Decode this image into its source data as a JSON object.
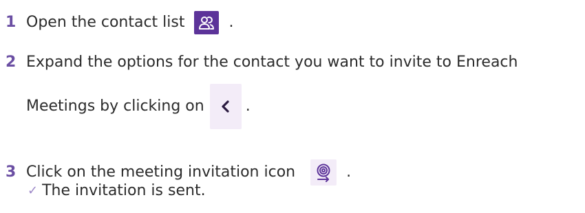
{
  "steps": [
    {
      "number": "1",
      "text": "Open the contact list",
      "icon": "contacts-icon",
      "trail": "."
    },
    {
      "number": "2",
      "line1": "Expand the options for the contact you want to invite to Enreach",
      "line2": "Meetings by clicking on",
      "icon": "chevron-left-icon",
      "trail": "."
    },
    {
      "number": "3",
      "text": "Click on the meeting invitation icon",
      "icon": "meeting-invitation-icon",
      "trail": "."
    }
  ],
  "result": {
    "icon": "checkmark-icon",
    "text": "The invitation is sent."
  },
  "colors": {
    "step_number": "#6b4fa3",
    "contacts_icon_bg": "#5c3399",
    "light_icon_bg": "#f3ecf8",
    "icon_purple": "#5c3399",
    "check": "#9b86c7"
  }
}
